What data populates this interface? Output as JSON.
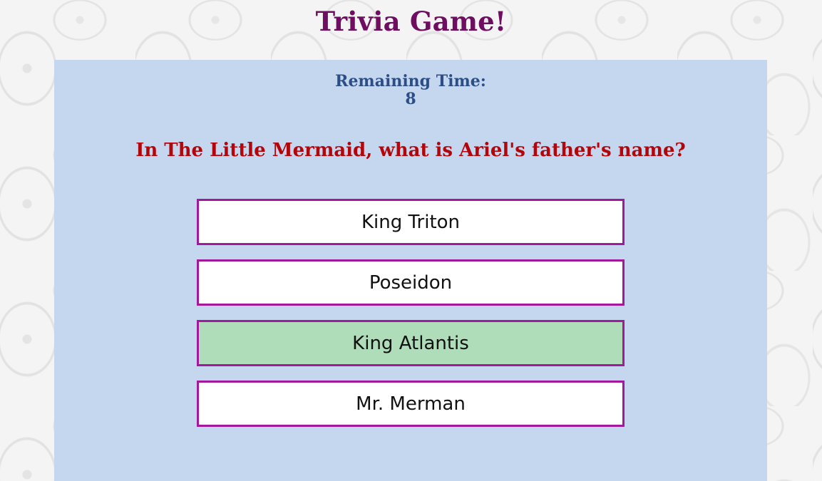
{
  "header": {
    "title": "Trivia Game!"
  },
  "timer": {
    "label": "Remaining Time:",
    "value": "8"
  },
  "question": {
    "text": "In The Little Mermaid, what is Ariel's father's name?"
  },
  "answers": [
    {
      "label": "King Triton",
      "highlighted": false
    },
    {
      "label": "Poseidon",
      "highlighted": false
    },
    {
      "label": "King Atlantis",
      "highlighted": true
    },
    {
      "label": "Mr. Merman",
      "highlighted": false
    }
  ],
  "colors": {
    "title": "#6f0e60",
    "panel": "#c5d6ef",
    "timer": "#2c4e86",
    "question": "#b2060b",
    "answer_border": "#a2199b",
    "answer_highlight": "#afdcb9"
  }
}
